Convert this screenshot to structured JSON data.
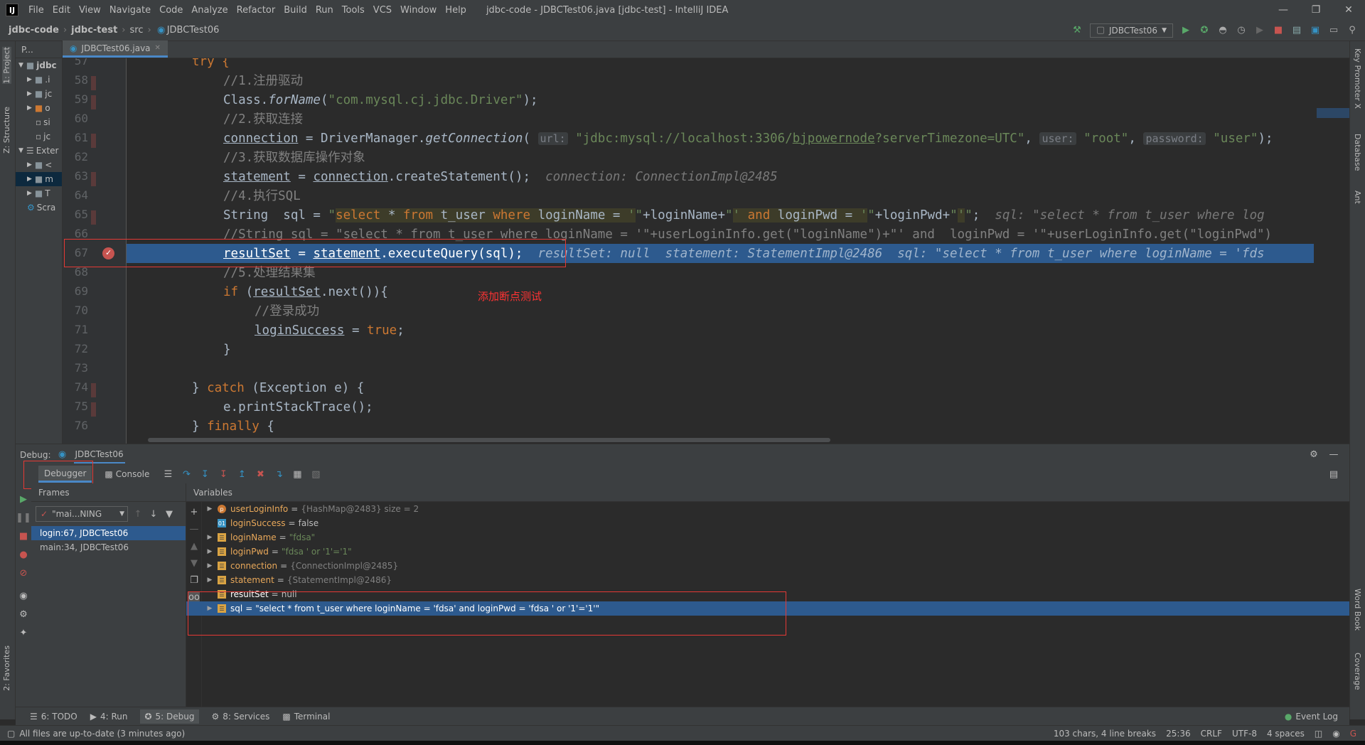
{
  "menubar": {
    "logo": "IJ",
    "items": [
      "File",
      "Edit",
      "View",
      "Navigate",
      "Code",
      "Analyze",
      "Refactor",
      "Build",
      "Run",
      "Tools",
      "VCS",
      "Window",
      "Help"
    ],
    "title": "jdbc-code - JDBCTest06.java [jdbc-test] - IntelliJ IDEA"
  },
  "navbar": {
    "crumbs": [
      "jdbc-code",
      "jdbc-test",
      "src",
      "JDBCTest06"
    ],
    "run_config": "JDBCTest06"
  },
  "left_strip": {
    "project": "1: Project",
    "structure": "Z: Structure",
    "favorites": "2: Favorites"
  },
  "right_strip": {
    "key_promoter": "Key Promoter X",
    "database": "Database",
    "ant": "Ant",
    "word_book": "Word Book",
    "coverage": "Coverage"
  },
  "project_panel": {
    "header": "P...",
    "rows": [
      "jdbc",
      ".i",
      "jc",
      "o",
      "si",
      "jc",
      "Exter",
      "<",
      "m",
      "T",
      "Scra"
    ]
  },
  "editor": {
    "tab": "JDBCTest06.java",
    "line_numbers": [
      "57",
      "58",
      "59",
      "60",
      "61",
      "62",
      "63",
      "64",
      "65",
      "66",
      "67",
      "68",
      "69",
      "70",
      "71",
      "72",
      "73",
      "74",
      "75",
      "76"
    ],
    "annotation": "添加断点测试"
  },
  "debug": {
    "label": "Debug:",
    "session": "JDBCTest06",
    "tab_debugger": "Debugger",
    "tab_console": "Console",
    "frames_title": "Frames",
    "thread": "\"mai...NING",
    "frames": [
      "login:67, JDBCTest06",
      "main:34, JDBCTest06"
    ],
    "variables_title": "Variables",
    "variables": [
      {
        "name": "userLoginInfo",
        "eq": "=",
        "val": "{HashMap@2483}  size = 2",
        "expand": true,
        "kind": "param"
      },
      {
        "name": "loginSuccess",
        "eq": "=",
        "val": "false",
        "expand": false,
        "kind": "bool"
      },
      {
        "name": "loginName",
        "eq": "=",
        "val": "\"fdsa\"",
        "expand": true,
        "kind": "local"
      },
      {
        "name": "loginPwd",
        "eq": "=",
        "val": "\"fdsa ' or '1'='1\"",
        "expand": true,
        "kind": "local"
      },
      {
        "name": "connection",
        "eq": "=",
        "val": "{ConnectionImpl@2485}",
        "expand": true,
        "kind": "local"
      },
      {
        "name": "statement",
        "eq": "=",
        "val": "{StatementImpl@2486}",
        "expand": true,
        "kind": "local"
      },
      {
        "name": "resultSet",
        "eq": "=",
        "val": "null",
        "expand": false,
        "kind": "local"
      },
      {
        "name": "sql",
        "eq": "=",
        "val": "\"select * from t_user where loginName = 'fdsa' and loginPwd = 'fdsa ' or '1'='1'\"",
        "expand": true,
        "kind": "local"
      }
    ]
  },
  "bottom_tabs": {
    "todo": "6: TODO",
    "run": "4: Run",
    "debug": "5: Debug",
    "services": "8: Services",
    "terminal": "Terminal",
    "event_log": "Event Log"
  },
  "status": {
    "left": "All files are up-to-date (3 minutes ago)",
    "chars": "103 chars, 4 line breaks",
    "position": "25:36",
    "line_sep": "CRLF",
    "encoding": "UTF-8",
    "indent": "4 spaces"
  },
  "colors": {
    "selection": "#2d5a8e",
    "keyword": "#cc7832",
    "string": "#6a8759",
    "comment": "#808080",
    "annotation_red": "#ff3333"
  }
}
